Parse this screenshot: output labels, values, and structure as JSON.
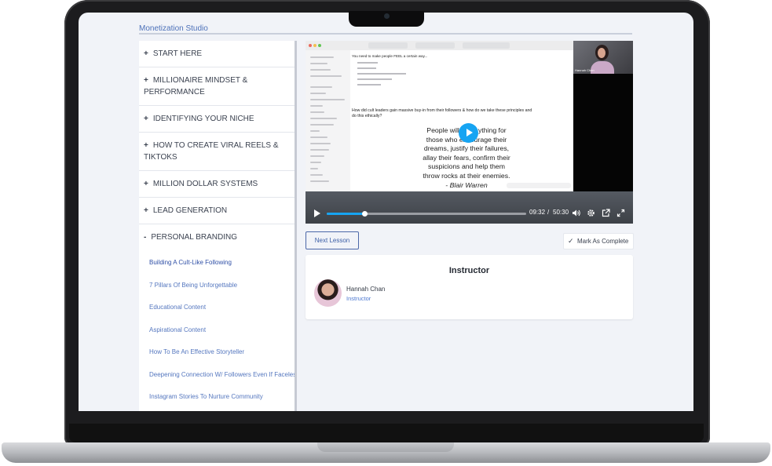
{
  "app": {
    "brand": "Monetization Studio"
  },
  "sidebar": {
    "modules": [
      {
        "symbol": "+",
        "title": "START HERE"
      },
      {
        "symbol": "+",
        "title": "MILLIONAIRE MINDSET & PERFORMANCE"
      },
      {
        "symbol": "+",
        "title": "IDENTIFYING YOUR NICHE"
      },
      {
        "symbol": "+",
        "title": "HOW TO CREATE VIRAL REELS & TIKTOKS"
      },
      {
        "symbol": "+",
        "title": "MILLION DOLLAR SYSTEMS"
      },
      {
        "symbol": "+",
        "title": "LEAD GENERATION"
      },
      {
        "symbol": "-",
        "title": "PERSONAL BRANDING"
      }
    ],
    "lessons": [
      {
        "title": "Building A Cult-Like Following",
        "active": true
      },
      {
        "title": "7 Pillars Of Being Unforgettable"
      },
      {
        "title": "Educational Content"
      },
      {
        "title": "Aspirational Content"
      },
      {
        "title": "How To Be An Effective Storyteller"
      },
      {
        "title": "Deepening Connection W/ Followers Even If Faceless"
      },
      {
        "title": "Instagram Stories To Nurture Community"
      }
    ]
  },
  "video": {
    "doc_heading": "You need to make people FEEL a certain way...",
    "doc_question": "How did cult leaders gain massive buy-in from their followers & how do we take these principles and do this ethically?",
    "quote_lines": [
      "People will do anything for",
      "those who encourage their",
      "dreams, justify their failures,",
      "allay their fears, confirm their",
      "suspicions and help them",
      "throw rocks at their enemies."
    ],
    "quote_author": "- Blair Warren",
    "webcam_name": "Hannah Chan",
    "current_time": "09:32",
    "separator": "/",
    "duration": "50:30",
    "progress_fraction": 0.189,
    "accent_color": "#16a4f2"
  },
  "actions": {
    "next_lesson": "Next Lesson",
    "mark_complete": "Mark As Complete"
  },
  "instructor": {
    "heading": "Instructor",
    "name": "Hannah Chan",
    "role": "Instructor"
  }
}
